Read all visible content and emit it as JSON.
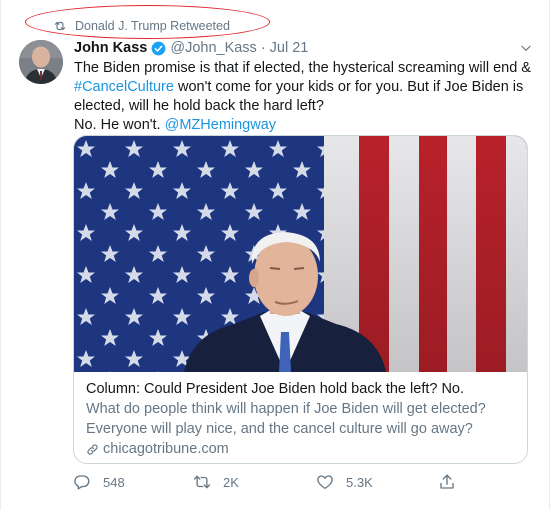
{
  "retweet": {
    "label": "Donald J. Trump Retweeted"
  },
  "tweet": {
    "author_name": "John Kass",
    "handle": "@John_Kass",
    "separator": "·",
    "date": "Jul 21",
    "text_line1": "The Biden promise is that if elected, the hysterical screaming will end &",
    "hashtag": "#CancelCulture",
    "text_line2_rest": " won't come for your kids or for you. But if Joe Biden is",
    "text_line3": "elected, will he hold back the hard left?",
    "text_line4": "No. He won't. ",
    "mention": "@MZHemingway"
  },
  "card": {
    "title": "Column: Could President Joe Biden hold back the left? No.",
    "description_line1": "What do people think will happen if Joe Biden will get elected?",
    "description_line2": "Everyone will play nice, and the cancel culture will go away?",
    "domain": "chicagotribune.com"
  },
  "actions": {
    "replies": "548",
    "retweets": "2K",
    "likes": "5.3K"
  },
  "colors": {
    "link": "#1b95e0",
    "muted": "#657786",
    "verified": "#1da1f2",
    "annotation_oval": "#e0252b"
  },
  "icons": [
    "retweet-icon",
    "verified-badge-icon",
    "chevron-down-icon",
    "link-icon",
    "reply-icon",
    "like-icon",
    "share-icon"
  ]
}
